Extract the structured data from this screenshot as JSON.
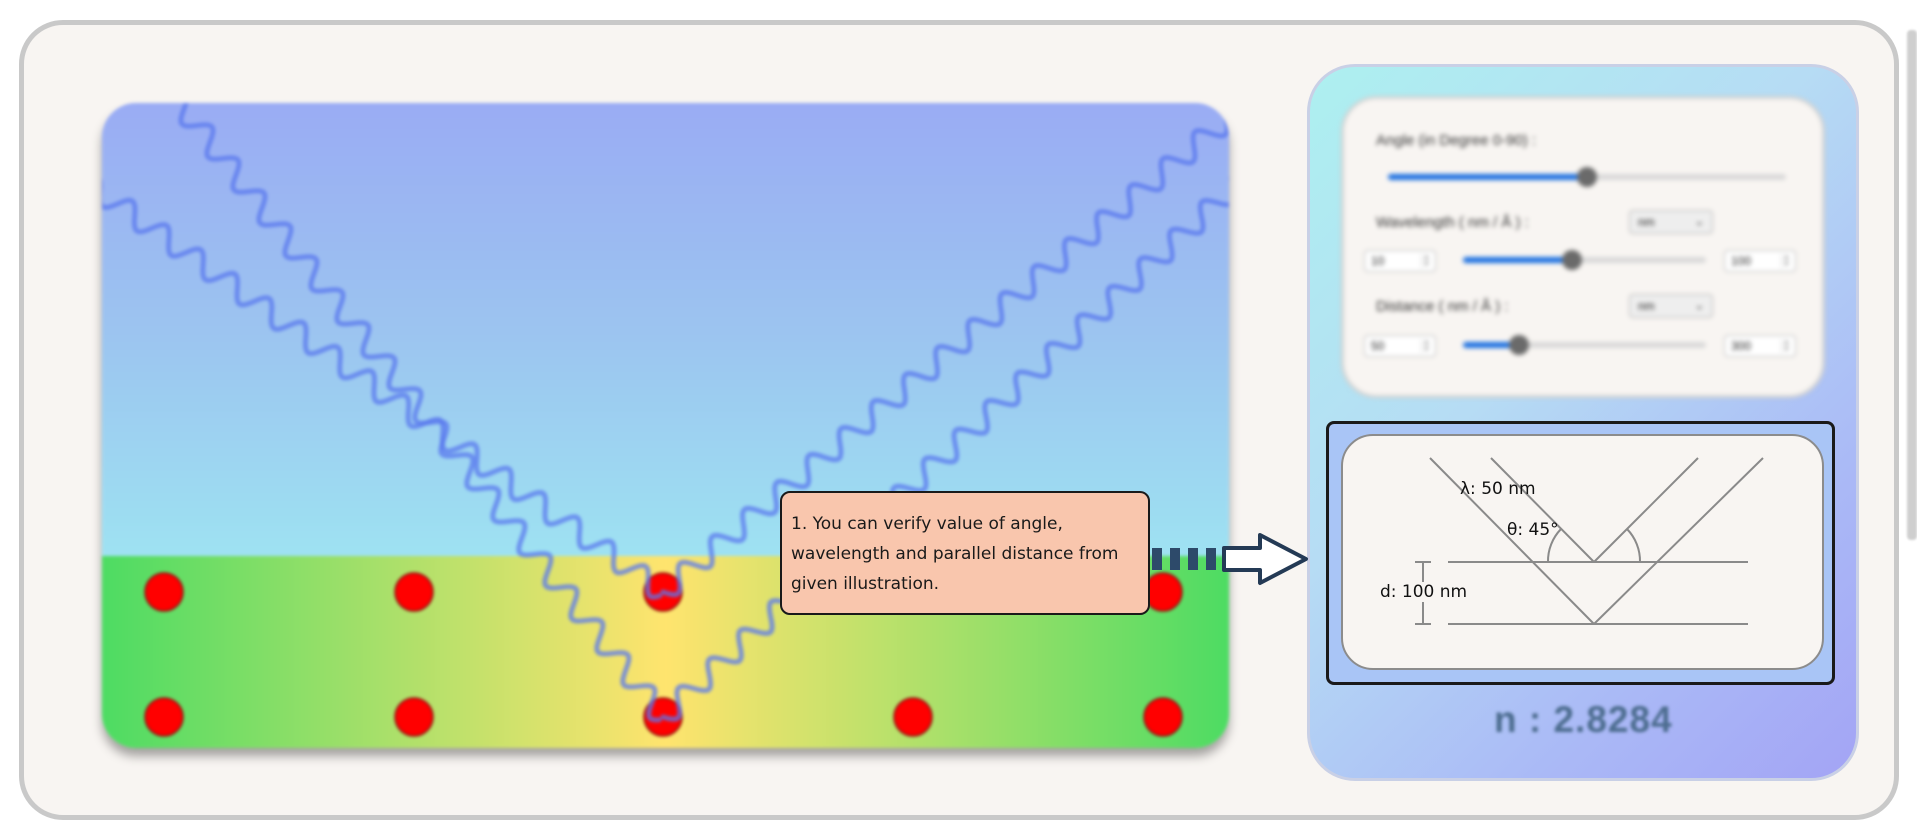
{
  "controls": {
    "angle": {
      "label": "Angle (in Degree 0-90) :",
      "value_fraction": 0.5
    },
    "wavelength": {
      "label": "Wavelength ( nm / Å ) :",
      "unit": "nm",
      "min": "10",
      "max": "100",
      "value_fraction": 0.45
    },
    "distance": {
      "label": "Distance ( nm / Å ) :",
      "unit": "nm",
      "min": "50",
      "max": "300",
      "value_fraction": 0.23
    }
  },
  "illustration": {
    "wavelength": "λ: 50 nm",
    "angle": "θ: 45°",
    "distance": "d: 100 nm"
  },
  "result": {
    "n": "n : 2.8284"
  },
  "tutorial": {
    "text": "1. You can verify value of angle, wavelength and parallel distance from given illustration."
  },
  "colors": {
    "atom": "#ff0000",
    "wave": "#5a78ee",
    "accent_slider": "#1b6fe0",
    "tooltip_bg": "#f9c6ad"
  }
}
